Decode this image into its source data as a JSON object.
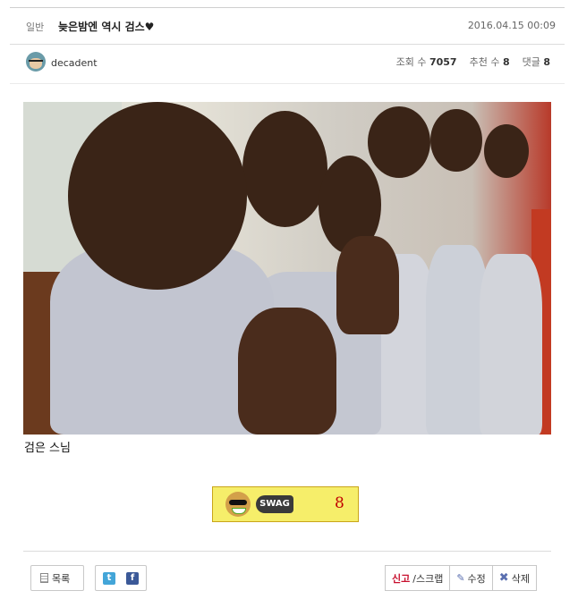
{
  "header": {
    "category": "일반",
    "title": "늦은밤엔 역시 검스♥",
    "date": "2016.04.15 00:09"
  },
  "meta": {
    "author": "decadent",
    "views_label": "조회 수",
    "views": "7057",
    "recommend_label": "추천 수",
    "recommend": "8",
    "comments_label": "댓글",
    "comments": "8"
  },
  "post": {
    "caption": "검은 스님"
  },
  "swag": {
    "tag": "SWAG",
    "count": "8"
  },
  "footer": {
    "list_label": "목록",
    "twitter_letter": "t",
    "facebook_letter": "f",
    "report_label": "신고",
    "scrap_label": "/스크랩",
    "edit_label": "수정",
    "delete_label": "삭제"
  },
  "icons": [
    "avatar",
    "list-icon",
    "twitter-icon",
    "facebook-icon",
    "pencil-icon",
    "x-icon",
    "swag-emoticon"
  ],
  "colors": {
    "swag_bg": "#f6ee6a",
    "swag_count": "#c00000",
    "report": "#c8102e",
    "twitter": "#43a5d8",
    "facebook": "#3b5998"
  }
}
